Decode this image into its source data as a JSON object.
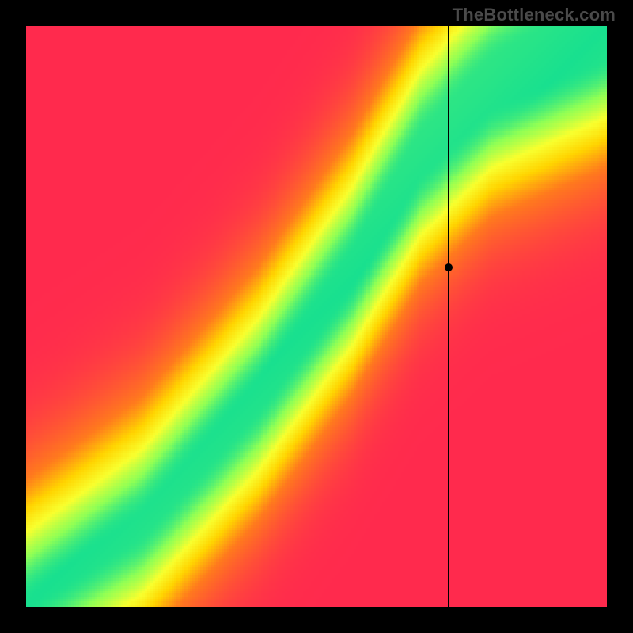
{
  "watermark": "TheBottleneck.com",
  "chart_data": {
    "type": "heatmap",
    "title": "",
    "xlabel": "",
    "ylabel": "",
    "xlim": [
      0,
      1
    ],
    "ylim": [
      0,
      1
    ],
    "crosshair": {
      "x": 0.727,
      "y": 0.585
    },
    "marker": {
      "x": 0.727,
      "y": 0.585
    },
    "color_stops": [
      {
        "at": 0.0,
        "color": "#ff2a4d"
      },
      {
        "at": 0.35,
        "color": "#ff7a1d"
      },
      {
        "at": 0.55,
        "color": "#ffd400"
      },
      {
        "at": 0.72,
        "color": "#f8ff2e"
      },
      {
        "at": 0.88,
        "color": "#8fff55"
      },
      {
        "at": 1.0,
        "color": "#18e08f"
      }
    ],
    "ridge": {
      "description": "Optimal-match ridge from bottom-left to top-right, slightly S-curved",
      "control_points": [
        {
          "x": 0.02,
          "y": 0.02
        },
        {
          "x": 0.2,
          "y": 0.14
        },
        {
          "x": 0.4,
          "y": 0.36
        },
        {
          "x": 0.56,
          "y": 0.58
        },
        {
          "x": 0.68,
          "y": 0.78
        },
        {
          "x": 0.8,
          "y": 0.9
        },
        {
          "x": 0.98,
          "y": 0.99
        }
      ],
      "width_profile": [
        {
          "x": 0.02,
          "half_width": 0.01
        },
        {
          "x": 0.2,
          "half_width": 0.02
        },
        {
          "x": 0.4,
          "half_width": 0.028
        },
        {
          "x": 0.6,
          "half_width": 0.038
        },
        {
          "x": 0.8,
          "half_width": 0.052
        },
        {
          "x": 0.98,
          "half_width": 0.07
        }
      ]
    },
    "falloff": {
      "sigma_perp": 0.18,
      "upper_left_penalty": 1.25,
      "lower_right_penalty": 1.35
    },
    "grid_resolution": 220
  }
}
